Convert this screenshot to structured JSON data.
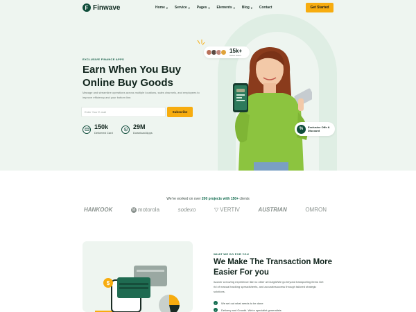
{
  "brand": {
    "name": "Finwave",
    "logo_letter": "F"
  },
  "nav": {
    "items": [
      {
        "label": "Home",
        "chevron": true
      },
      {
        "label": "Service",
        "chevron": true
      },
      {
        "label": "Pages",
        "chevron": true
      },
      {
        "label": "Elements",
        "chevron": true
      },
      {
        "label": "Blog",
        "chevron": true
      },
      {
        "label": "Contact",
        "chevron": false
      }
    ],
    "cta_label": "Get Started"
  },
  "hero": {
    "eyebrow": "EXCLUSIVE FINANCE APPS",
    "headline_line1": "Earn When You Buy",
    "headline_line2": "Online Buy Goods",
    "description": "Manage and streamline operations across multiple locations, sales channels, and employees to improve efficiency and your bottom line.",
    "email_placeholder": "Enter Your E-mail",
    "subscribe_label": "Subscribe",
    "stats": [
      {
        "value": "150k",
        "label": "Delivered Card",
        "icon": "card-icon"
      },
      {
        "value": "29M",
        "label": "Download Apps",
        "icon": "download-icon"
      }
    ],
    "users_badge": {
      "value": "15k+",
      "label": "Active Users"
    },
    "offer_badge": {
      "line1": "Exclusive Offe &",
      "line2": "Discount",
      "icon": "percent-icon"
    }
  },
  "clients": {
    "title_prefix": "We've worked on over ",
    "title_highlight": "200 projects with 150+",
    "title_suffix": " clients",
    "logos": [
      "HANKOOK",
      "motorola",
      "sodexo",
      "VERTIV",
      "AUSTRIAN",
      "OMRON"
    ]
  },
  "features": {
    "eyebrow": "WHAT WE DO FOR YOU",
    "headline": "We Make The Transaction More Easier For you",
    "description": "iscover a moving experience like no other at OutgridWe go beyond transporting items Get rid of manual tracking spreadsheets, and accuratesuccess through tailored strategic solutions.",
    "checklist": [
      "We set out what needs to be done",
      "Delivery and Growth. We're specialist generalists"
    ]
  },
  "colors": {
    "primary": "#0f4d3a",
    "accent": "#f7ac0f",
    "hero_bg": "#eef5f0"
  }
}
